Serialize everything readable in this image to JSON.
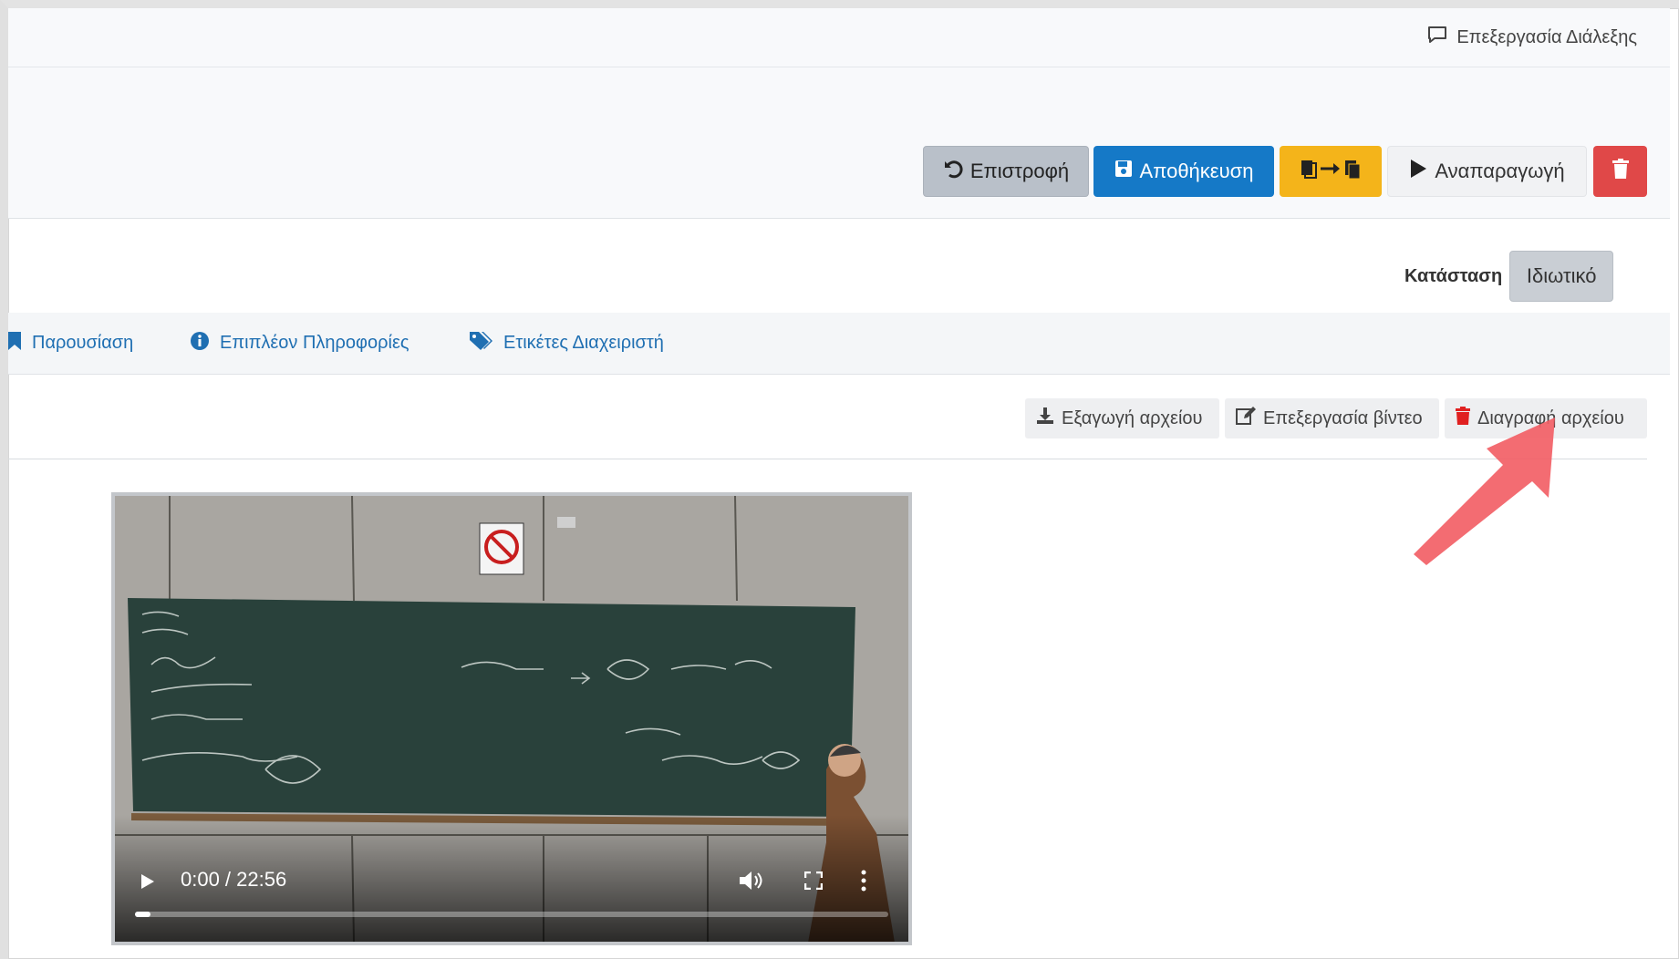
{
  "header": {
    "edit_lecture_label": "Επεξεργασία Διάλεξης"
  },
  "toolbar": {
    "back_label": "Επιστροφή",
    "save_label": "Αποθήκευση",
    "play_label": "Αναπαραγωγή"
  },
  "status": {
    "label": "Κατάσταση",
    "value": "Ιδιωτικό"
  },
  "tabs": [
    {
      "label": "Παρουσίαση",
      "icon": "bookmark-icon"
    },
    {
      "label": "Επιπλέον Πληροφορίες",
      "icon": "info-icon"
    },
    {
      "label": "Ετικέτες Διαχειριστή",
      "icon": "tags-icon"
    }
  ],
  "file_actions": {
    "export_label": "Εξαγωγή αρχείου",
    "edit_video_label": "Επεξεργασία βίντεο",
    "delete_file_label": "Διαγραφή αρχείου"
  },
  "video": {
    "time": "0:00 / 22:56",
    "progress": 0.02
  },
  "colors": {
    "primary": "#1579c7",
    "warning": "#f4b41a",
    "danger": "#e04848",
    "annotation_arrow": "#f25f66"
  }
}
